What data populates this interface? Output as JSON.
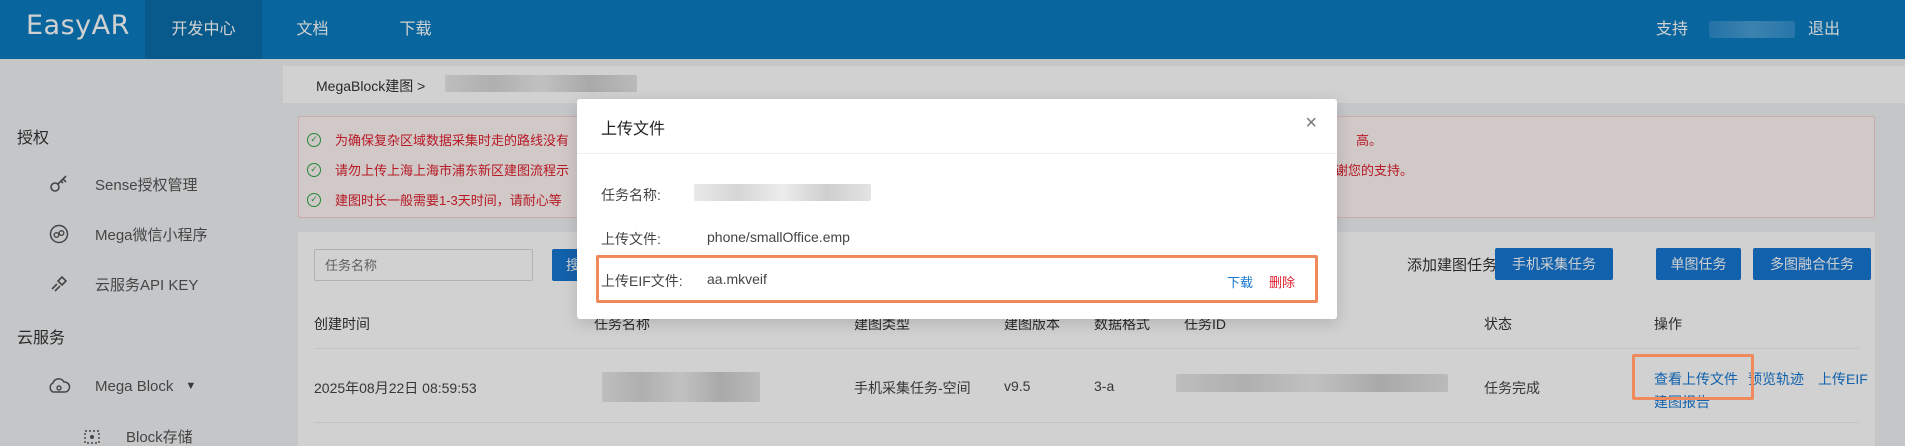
{
  "topbar": {
    "logo": "EasyAR",
    "nav": [
      {
        "label": "开发中心",
        "active": true
      },
      {
        "label": "文档",
        "active": false
      },
      {
        "label": "下载",
        "active": false
      }
    ],
    "support": "支持",
    "logout": "退出"
  },
  "sidebar": {
    "auth_header": "授权",
    "auth_items": [
      {
        "label": "Sense授权管理",
        "icon": "sense-icon"
      },
      {
        "label": "Mega微信小程序",
        "icon": "mega-wechat-icon"
      },
      {
        "label": "云服务API KEY",
        "icon": "api-key-icon"
      }
    ],
    "cloud_header": "云服务",
    "mega_block": "Mega Block",
    "block_storage": "Block存储"
  },
  "breadcrumb": {
    "root": "MegaBlock建图 >"
  },
  "alerts": [
    {
      "text": "为确保复杂区域数据采集时走的路线没有",
      "tail": "高。"
    },
    {
      "text": "请勿上传上海上海市浦东新区建图流程示",
      "tail": "谢您的支持。"
    },
    {
      "text": "建图时长一般需要1-3天时间，请耐心等",
      "tail": ""
    }
  ],
  "toolbar": {
    "search_placeholder": "任务名称",
    "search_button": "搜",
    "add_label": "添加建图任务:",
    "buttons": [
      "手机采集任务",
      "单图任务",
      "多图融合任务"
    ]
  },
  "table": {
    "headers": [
      "创建时间",
      "任务名称",
      "建图类型",
      "建图版本",
      "数据格式",
      "任务ID",
      "状态",
      "操作"
    ],
    "row": {
      "created": "2025年08月22日 08:59:53",
      "type": "手机采集任务-空间",
      "version": "v9.5",
      "format": "3-a",
      "status": "任务完成",
      "actions": [
        "查看上传文件",
        "预览轨迹",
        "上传EIF",
        "建图报告"
      ]
    }
  },
  "modal": {
    "title": "上传文件",
    "close": "×",
    "task_name_label": "任务名称:",
    "upload_file_label": "上传文件:",
    "upload_file_value": "phone/smallOffice.emp",
    "eif_label": "上传EIF文件:",
    "eif_value": "aa.mkveif",
    "download": "下载",
    "delete": "删除"
  },
  "colors": {
    "topbar": "#0a7cc0",
    "primary": "#1677d2",
    "danger": "#e0202e",
    "highlight": "#f08a5d"
  }
}
